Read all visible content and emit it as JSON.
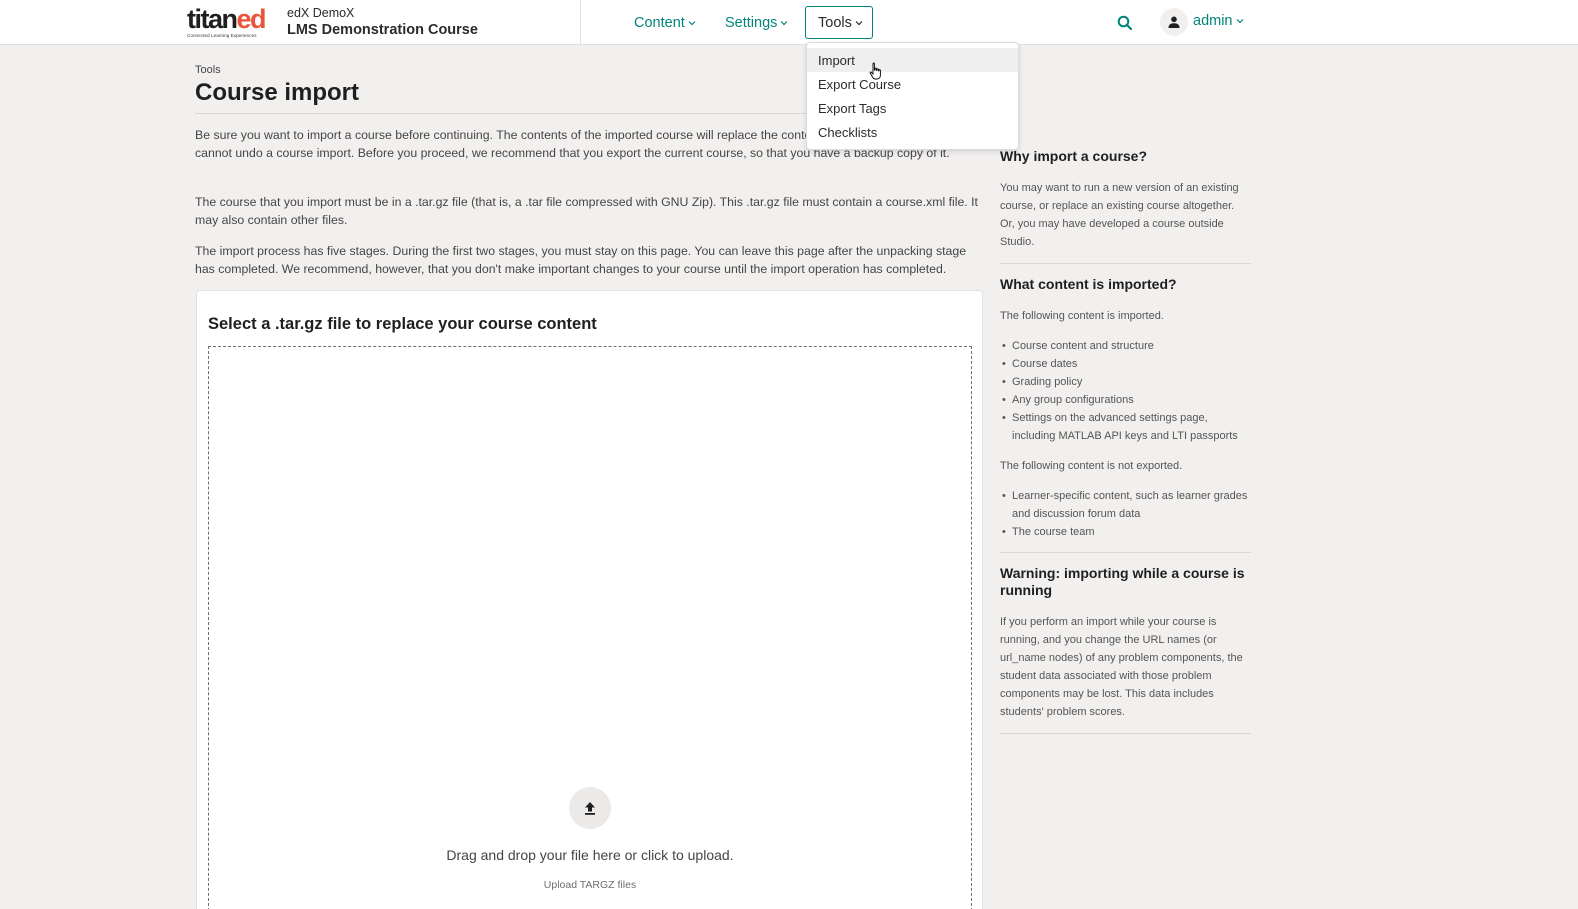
{
  "header": {
    "logo": {
      "part1": "titan",
      "part2": "ed",
      "tagline": "Connected Learning Experiences"
    },
    "course_org": "edX DemoX",
    "course_name": "LMS Demonstration Course",
    "nav": {
      "content": "Content",
      "settings": "Settings",
      "tools": "Tools"
    },
    "search_icon": "search-icon",
    "user_name": "admin",
    "accent_color": "#00857a"
  },
  "tools_menu": [
    "Import",
    "Export Course",
    "Export Tags",
    "Checklists"
  ],
  "main": {
    "breadcrumb": "Tools",
    "title": "Course import",
    "intro": [
      "Be sure you want to import a course before continuing. The contents of the imported course will replace the contents of the existing course. You cannot undo a course import. Before you proceed, we recommend that you export the current course, so that you have a backup copy of it.",
      "The course that you import must be in a .tar.gz file (that is, a .tar file compressed with GNU Zip). This .tar.gz file must contain a course.xml file. It may also contain other files.",
      "The import process has five stages. During the first two stages, you must stay on this page. You can leave this page after the unpacking stage has completed. We recommend, however, that you don't make important changes to your course until the import operation has completed."
    ],
    "card_title": "Select a .tar.gz file to replace your course content",
    "dropzone_text": "Drag and drop your file here or click to upload.",
    "dropzone_subtext": "Upload TARGZ files"
  },
  "sidebar": {
    "why_title": "Why import a course?",
    "why_text": "You may want to run a new version of an existing course, or replace an existing course altogether. Or, you may have developed a course outside Studio.",
    "what_title": "What content is imported?",
    "what_intro": "The following content is imported.",
    "imported": [
      "Course content and structure",
      "Course dates",
      "Grading policy",
      "Any group configurations",
      "Settings on the advanced settings page, including MATLAB API keys and LTI passports"
    ],
    "not_intro": "The following content is not exported.",
    "not_exported": [
      "Learner-specific content, such as learner grades and discussion forum data",
      "The course team"
    ],
    "warning_title": "Warning: importing while a course is running",
    "warning_text": "If you perform an import while your course is running, and you change the URL names (or url_name nodes) of any problem components, the student data associated with those problem components may be lost. This data includes students' problem scores."
  }
}
